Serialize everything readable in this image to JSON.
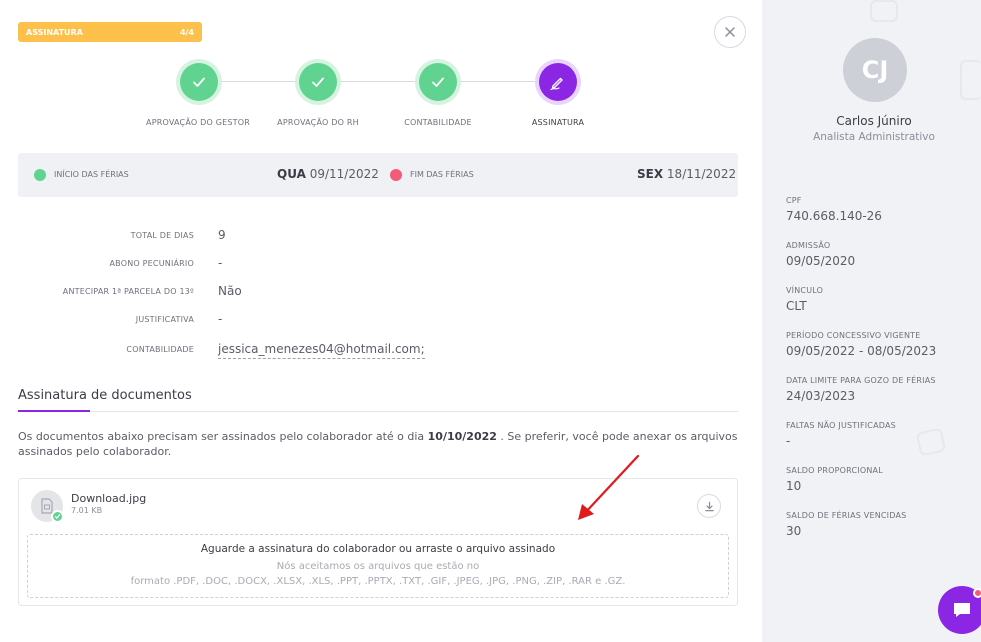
{
  "header": {
    "badge_label": "ASSINATURA",
    "badge_step": "4/4",
    "close_icon": "close-icon"
  },
  "steps": [
    {
      "label": "APROVAÇÃO DO GESTOR",
      "status": "done",
      "icon": "check-icon"
    },
    {
      "label": "APROVAÇÃO DO RH",
      "status": "done",
      "icon": "check-icon"
    },
    {
      "label": "CONTABILIDADE",
      "status": "done",
      "icon": "check-icon"
    },
    {
      "label": "ASSINATURA",
      "status": "active",
      "icon": "signature-pen-icon"
    }
  ],
  "dates": {
    "start_label": "INÍCIO DAS FÉRIAS",
    "start_weekday": "QUA",
    "start_date": "09/11/2022",
    "end_label": "FIM DAS FÉRIAS",
    "end_weekday": "SEX",
    "end_date": "18/11/2022",
    "start_color": "#5fd38f",
    "end_color": "#f25c78"
  },
  "details": [
    {
      "label": "TOTAL DE DIAS",
      "value": "9"
    },
    {
      "label": "ABONO PECUNIÁRIO",
      "value": "-"
    },
    {
      "label": "ANTECIPAR 1ª PARCELA DO 13º",
      "value": "Não"
    },
    {
      "label": "JUSTIFICATIVA",
      "value": "-"
    },
    {
      "label": "CONTABILIDADE",
      "value": "jessica_menezes04@hotmail.com;"
    }
  ],
  "signature": {
    "title": "Assinatura de documentos",
    "text_before": "Os documentos abaixo precisam ser assinados pelo colaborador até o dia ",
    "deadline": "10/10/2022",
    "text_after": " . Se preferir, você pode anexar os arquivos assinados pelo colaborador.",
    "file_name": "Download.jpg",
    "file_size": "7.01 KB",
    "dropzone_title": "Aguarde a assinatura do colaborador ou arraste o arquivo assinado",
    "dropzone_sub1": "Nós aceitamos os arquivos que estão no",
    "dropzone_sub2": "formato .PDF, .DOC, .DOCX, .XLSX, .XLS, .PPT, .PPTX, .TXT, .GIF, .JPEG, .JPG, .PNG, .ZIP, .RAR e .GZ."
  },
  "profile": {
    "initials": "CJ",
    "name": "Carlos Júniro",
    "role": "Analista Administrativo",
    "info": [
      {
        "label": "CPF",
        "value": "740.668.140-26"
      },
      {
        "label": "ADMISSÃO",
        "value": "09/05/2020"
      },
      {
        "label": "VÍNCULO",
        "value": "CLT"
      },
      {
        "label": "PERÍODO CONCESSIVO VIGENTE",
        "value": "09/05/2022 - 08/05/2023"
      },
      {
        "label": "DATA LIMITE PARA GOZO DE FÉRIAS",
        "value": "24/03/2023"
      },
      {
        "label": "FALTAS NÃO JUSTIFICADAS",
        "value": "-"
      },
      {
        "label": "SALDO PROPORCIONAL",
        "value": "10"
      },
      {
        "label": "SALDO DE FÉRIAS VENCIDAS",
        "value": "30"
      }
    ]
  },
  "colors": {
    "accent": "#8b26e4",
    "success": "#5fd38f",
    "badge": "#fdc04a"
  }
}
